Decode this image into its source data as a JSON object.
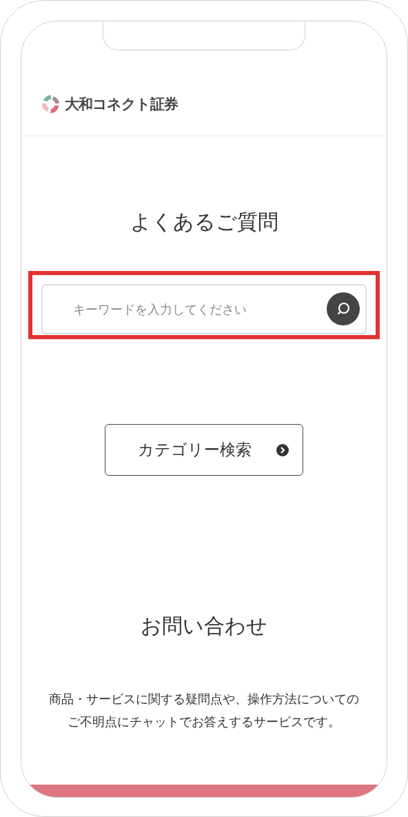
{
  "header": {
    "logo_text": "大和コネクト証券"
  },
  "faq": {
    "title": "よくあるご質問",
    "search": {
      "placeholder": "キーワードを入力してください",
      "highlighted": true
    },
    "category_button": "カテゴリー検索"
  },
  "contact": {
    "title": "お問い合わせ",
    "description": [
      "商品・サービスに関する疑問点や、操作方法についての",
      "ご不明点にチャットでお答えするサービスです。"
    ]
  }
}
